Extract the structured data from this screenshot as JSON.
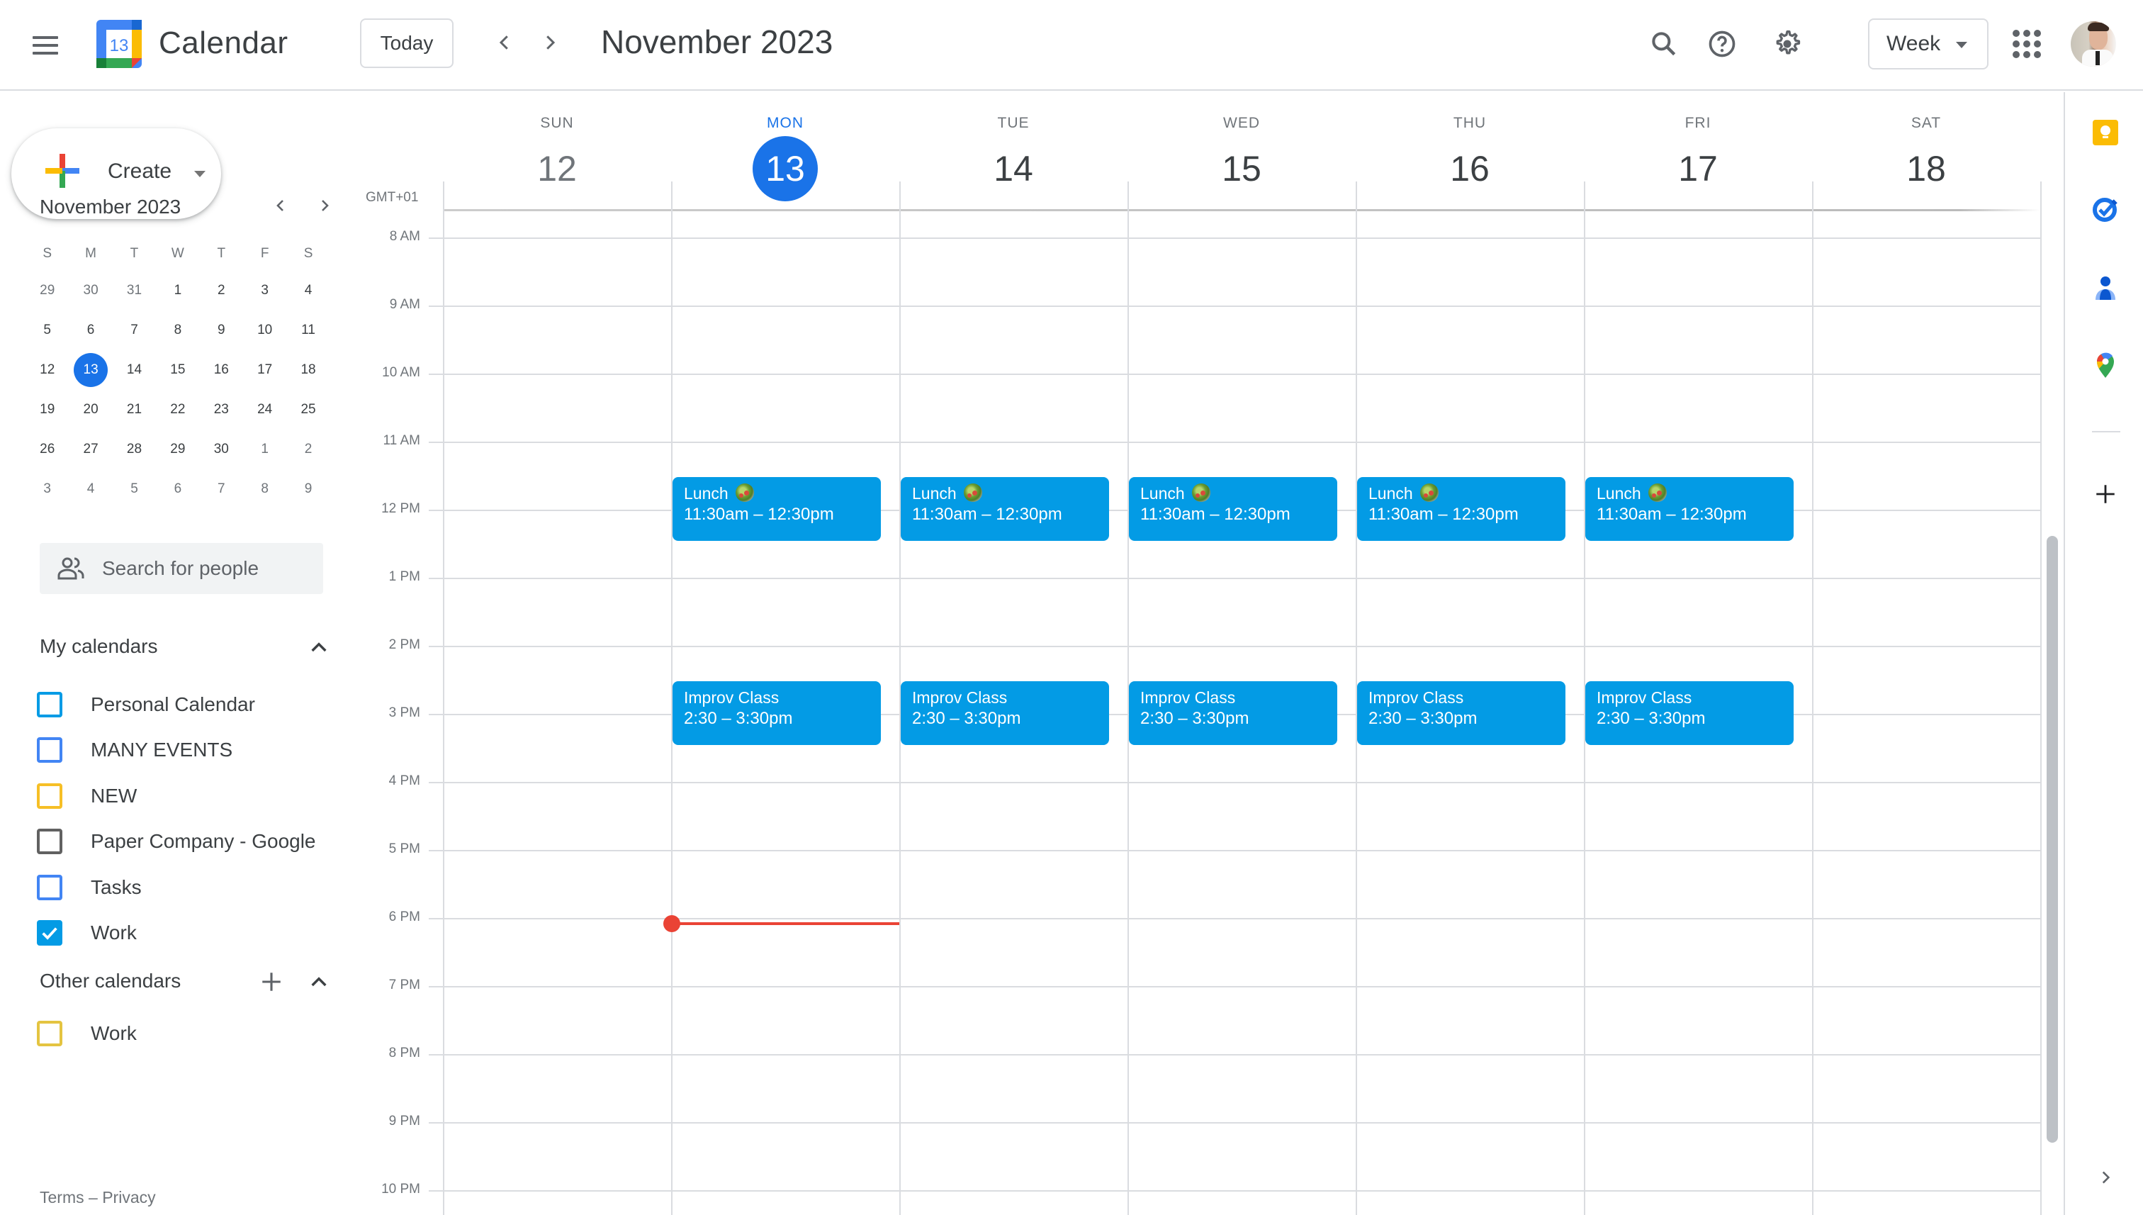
{
  "header": {
    "menu_icon": "hamburger-menu-icon",
    "logo_day": "13",
    "app_title": "Calendar",
    "today_label": "Today",
    "prev_icon": "chevron-left-icon",
    "next_icon": "chevron-right-icon",
    "current_range": "November 2023",
    "search_icon": "search-icon",
    "help_icon": "help-icon",
    "settings_icon": "gear-icon",
    "view_selected": "Week",
    "apps_icon": "apps-grid-icon",
    "avatar_icon": "account-avatar"
  },
  "sidebar": {
    "create_label": "Create",
    "mini_calendar": {
      "title": "November 2023",
      "weekday_labels": [
        "S",
        "M",
        "T",
        "W",
        "T",
        "F",
        "S"
      ],
      "weeks": [
        [
          {
            "d": "29",
            "o": true
          },
          {
            "d": "30",
            "o": true
          },
          {
            "d": "31",
            "o": true
          },
          {
            "d": "1"
          },
          {
            "d": "2"
          },
          {
            "d": "3"
          },
          {
            "d": "4"
          }
        ],
        [
          {
            "d": "5"
          },
          {
            "d": "6"
          },
          {
            "d": "7"
          },
          {
            "d": "8"
          },
          {
            "d": "9"
          },
          {
            "d": "10"
          },
          {
            "d": "11"
          }
        ],
        [
          {
            "d": "12"
          },
          {
            "d": "13",
            "today": true
          },
          {
            "d": "14"
          },
          {
            "d": "15"
          },
          {
            "d": "16"
          },
          {
            "d": "17"
          },
          {
            "d": "18"
          }
        ],
        [
          {
            "d": "19"
          },
          {
            "d": "20"
          },
          {
            "d": "21"
          },
          {
            "d": "22"
          },
          {
            "d": "23"
          },
          {
            "d": "24"
          },
          {
            "d": "25"
          }
        ],
        [
          {
            "d": "26"
          },
          {
            "d": "27"
          },
          {
            "d": "28"
          },
          {
            "d": "29"
          },
          {
            "d": "30"
          },
          {
            "d": "1",
            "o": true
          },
          {
            "d": "2",
            "o": true
          }
        ],
        [
          {
            "d": "3",
            "o": true
          },
          {
            "d": "4",
            "o": true
          },
          {
            "d": "5",
            "o": true
          },
          {
            "d": "6",
            "o": true
          },
          {
            "d": "7",
            "o": true
          },
          {
            "d": "8",
            "o": true
          },
          {
            "d": "9",
            "o": true
          }
        ]
      ]
    },
    "people_search_placeholder": "Search for people",
    "my_calendars": {
      "title": "My calendars",
      "items": [
        {
          "name": "Personal Calendar",
          "color": "#039be5",
          "checked": false
        },
        {
          "name": "MANY EVENTS",
          "color": "#4285f4",
          "checked": false
        },
        {
          "name": "NEW",
          "color": "#f6bf26",
          "checked": false
        },
        {
          "name": "Paper Company - Google",
          "color": "#616161",
          "checked": false
        },
        {
          "name": "Tasks",
          "color": "#4285f4",
          "checked": false
        },
        {
          "name": "Work",
          "color": "#039be5",
          "checked": true
        }
      ]
    },
    "other_calendars": {
      "title": "Other calendars",
      "items": [
        {
          "name": "Work",
          "color": "#e4c441",
          "checked": false
        }
      ]
    },
    "footer": {
      "terms": "Terms",
      "separator": "–",
      "privacy": "Privacy"
    }
  },
  "week": {
    "timezone": "GMT+01",
    "days": [
      {
        "dow": "SUN",
        "num": "12",
        "state": "past"
      },
      {
        "dow": "MON",
        "num": "13",
        "state": "today"
      },
      {
        "dow": "TUE",
        "num": "14",
        "state": "future"
      },
      {
        "dow": "WED",
        "num": "15",
        "state": "future"
      },
      {
        "dow": "THU",
        "num": "16",
        "state": "future"
      },
      {
        "dow": "FRI",
        "num": "17",
        "state": "future"
      },
      {
        "dow": "SAT",
        "num": "18",
        "state": "future"
      }
    ],
    "hours": [
      "8 AM",
      "9 AM",
      "10 AM",
      "11 AM",
      "12 PM",
      "1 PM",
      "2 PM",
      "3 PM",
      "4 PM",
      "5 PM",
      "6 PM",
      "7 PM",
      "8 PM",
      "9 PM",
      "10 PM"
    ],
    "first_visible_hour": 8,
    "events": [
      {
        "day": 1,
        "title": "Lunch",
        "emoji": "salad",
        "time": "11:30am – 12:30pm",
        "start": 11.5,
        "end": 12.5
      },
      {
        "day": 2,
        "title": "Lunch",
        "emoji": "salad",
        "time": "11:30am – 12:30pm",
        "start": 11.5,
        "end": 12.5
      },
      {
        "day": 3,
        "title": "Lunch",
        "emoji": "salad",
        "time": "11:30am – 12:30pm",
        "start": 11.5,
        "end": 12.5
      },
      {
        "day": 4,
        "title": "Lunch",
        "emoji": "salad",
        "time": "11:30am – 12:30pm",
        "start": 11.5,
        "end": 12.5
      },
      {
        "day": 5,
        "title": "Lunch",
        "emoji": "salad",
        "time": "11:30am – 12:30pm",
        "start": 11.5,
        "end": 12.5
      },
      {
        "day": 1,
        "title": "Improv Class",
        "time": "2:30 – 3:30pm",
        "start": 14.5,
        "end": 15.5
      },
      {
        "day": 2,
        "title": "Improv Class",
        "time": "2:30 – 3:30pm",
        "start": 14.5,
        "end": 15.5
      },
      {
        "day": 3,
        "title": "Improv Class",
        "time": "2:30 – 3:30pm",
        "start": 14.5,
        "end": 15.5
      },
      {
        "day": 4,
        "title": "Improv Class",
        "time": "2:30 – 3:30pm",
        "start": 14.5,
        "end": 15.5
      },
      {
        "day": 5,
        "title": "Improv Class",
        "time": "2:30 – 3:30pm",
        "start": 14.5,
        "end": 15.5
      }
    ],
    "event_color": "#039be5",
    "current_time": {
      "day": 1,
      "hour": 18.08
    },
    "accent_color": "#1a73e8",
    "now_color": "#ea4335"
  },
  "side_panel": {
    "icons": [
      "keep-icon",
      "tasks-icon",
      "contacts-icon",
      "maps-icon"
    ],
    "add_icon": "add-addon-icon",
    "expand_icon": "expand-panel-icon"
  }
}
